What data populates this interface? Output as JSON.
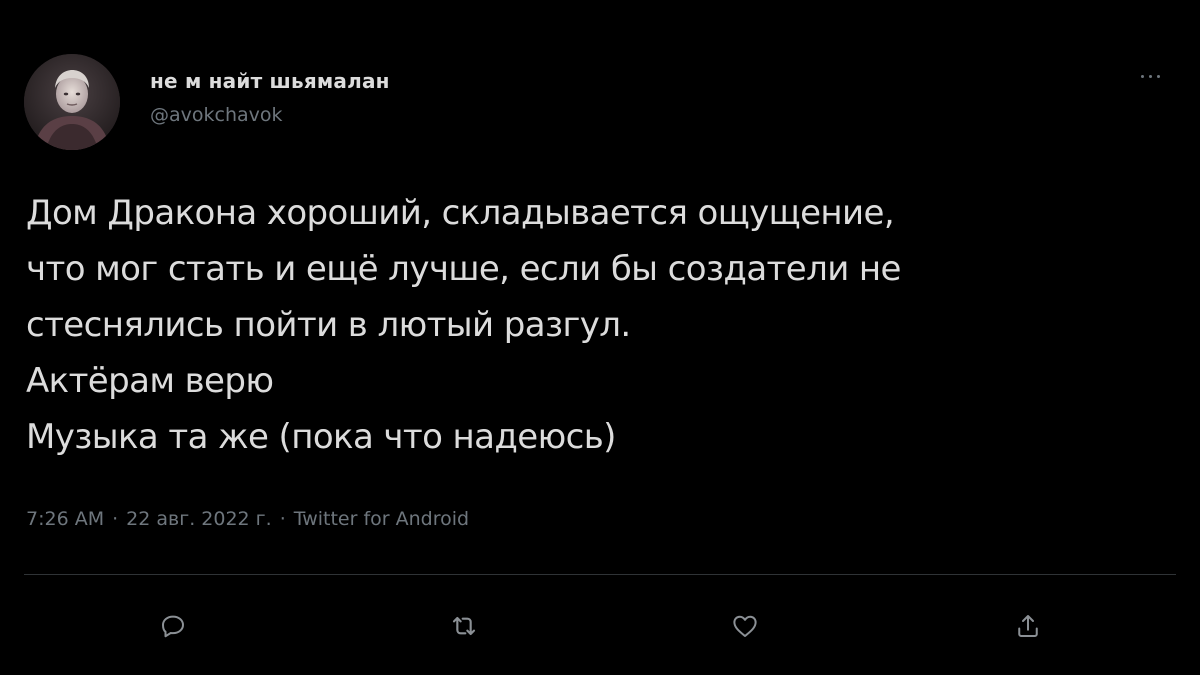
{
  "tweet": {
    "author": {
      "display_name": "не м найт шьямалан",
      "handle": "@avokchavok",
      "avatar_icon": "user-avatar-photo"
    },
    "more_icon": "more-dots-icon",
    "text_lines": [
      "Дом Дракона хороший, складывается ощущение,",
      "что мог стать и ещё лучше, если бы создатели не",
      "стеснялись пойти в лютый разгул.",
      "Актёрам верю",
      "Музыка та же (пока что надеюсь)"
    ],
    "meta": {
      "time": "7:26 AM",
      "separator": "·",
      "date": "22 авг. 2022 г.",
      "source": "Twitter for Android"
    },
    "actions": {
      "reply_icon": "reply-icon",
      "retweet_icon": "retweet-icon",
      "like_icon": "like-icon",
      "share_icon": "share-icon"
    }
  },
  "colors": {
    "background": "#000000",
    "text": "#dcdcdc",
    "secondary_text": "#6e767d",
    "divider": "#2f3336"
  }
}
